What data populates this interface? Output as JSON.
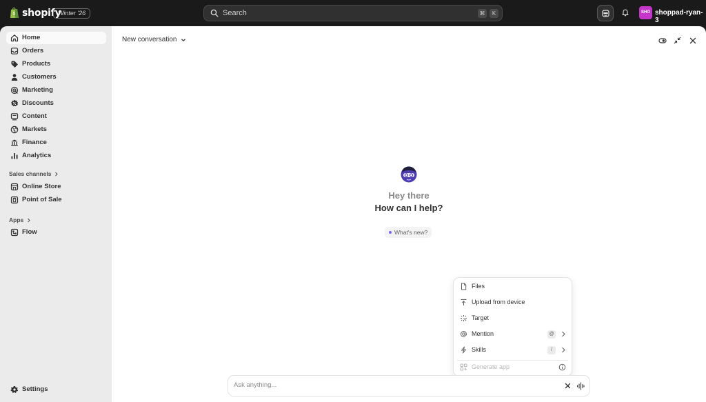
{
  "topbar": {
    "brand": "shopify",
    "edition": "Winter '26",
    "search_placeholder": "Search",
    "shortcut_keys": [
      "⌘",
      "K"
    ],
    "store_avatar_text": "SHO",
    "store_name": "shoppad-ryan-3",
    "store_avatar_color": "#c436c9"
  },
  "sidebar": {
    "items": [
      {
        "label": "Home",
        "icon": "home-icon",
        "active": true
      },
      {
        "label": "Orders",
        "icon": "inbox-icon"
      },
      {
        "label": "Products",
        "icon": "tag-icon"
      },
      {
        "label": "Customers",
        "icon": "person-icon"
      },
      {
        "label": "Marketing",
        "icon": "target-icon"
      },
      {
        "label": "Discounts",
        "icon": "discount-icon"
      },
      {
        "label": "Content",
        "icon": "content-icon"
      },
      {
        "label": "Markets",
        "icon": "globe-icon"
      },
      {
        "label": "Finance",
        "icon": "bank-icon"
      },
      {
        "label": "Analytics",
        "icon": "bar-chart-icon"
      }
    ],
    "sales_channels_label": "Sales channels",
    "sales_channels": [
      {
        "label": "Online Store",
        "icon": "store-icon"
      },
      {
        "label": "Point of Sale",
        "icon": "pos-icon"
      }
    ],
    "apps_label": "Apps",
    "apps": [
      {
        "label": "Flow",
        "icon": "flow-icon"
      }
    ],
    "settings_label": "Settings"
  },
  "conversation": {
    "title": "New conversation",
    "greeting": "Hey there",
    "prompt": "How can I help?",
    "whats_new": "What's new?",
    "accent": "#7b61ff"
  },
  "menu": {
    "items": [
      {
        "label": "Files",
        "icon": "file-icon"
      },
      {
        "label": "Upload from device",
        "icon": "upload-icon"
      },
      {
        "label": "Target",
        "icon": "target-select-icon"
      },
      {
        "label": "Mention",
        "icon": "at-icon",
        "key": "@"
      },
      {
        "label": "Skills",
        "icon": "bolt-icon",
        "key": "/"
      },
      {
        "label": "Generate app",
        "icon": "apps-icon",
        "disabled": true
      }
    ]
  },
  "ask": {
    "placeholder": "Ask anything..."
  }
}
